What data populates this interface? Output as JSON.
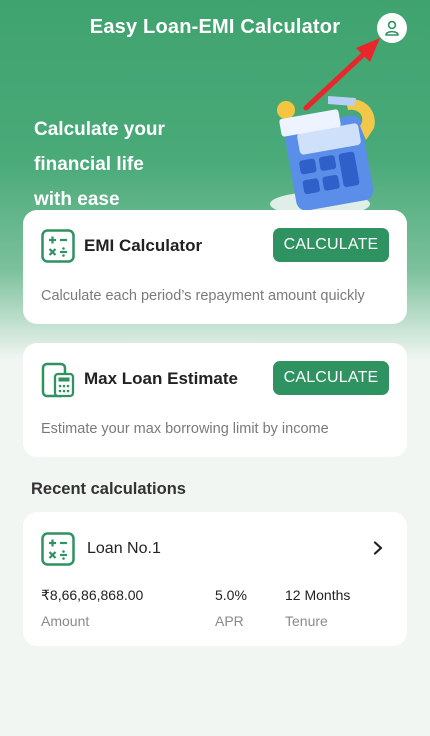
{
  "header": {
    "title": "Easy Loan-EMI Calculator",
    "profile_icon": "user-icon"
  },
  "hero": {
    "lines": [
      "Calculate your",
      "financial life",
      "with ease"
    ]
  },
  "emi_card": {
    "title": "EMI Calculator",
    "button": "CALCULATE",
    "description": "Calculate each period’s repayment amount quickly",
    "icon": "calculator-icon"
  },
  "max_card": {
    "title": "Max Loan Estimate",
    "button": "CALCULATE",
    "description": "Estimate your max borrowing limit by income",
    "icon": "phone-calculator-icon"
  },
  "recent": {
    "section_title": "Recent calculations",
    "items": [
      {
        "name": "Loan No.1",
        "amount": "₹8,66,86,868.00",
        "amount_label": "Amount",
        "apr": "5.0%",
        "apr_label": "APR",
        "tenure": "12 Months",
        "tenure_label": "Tenure"
      }
    ]
  },
  "colors": {
    "primary": "#2e9261",
    "header_green": "#3fa36f",
    "annotation_red": "#e8262b"
  }
}
